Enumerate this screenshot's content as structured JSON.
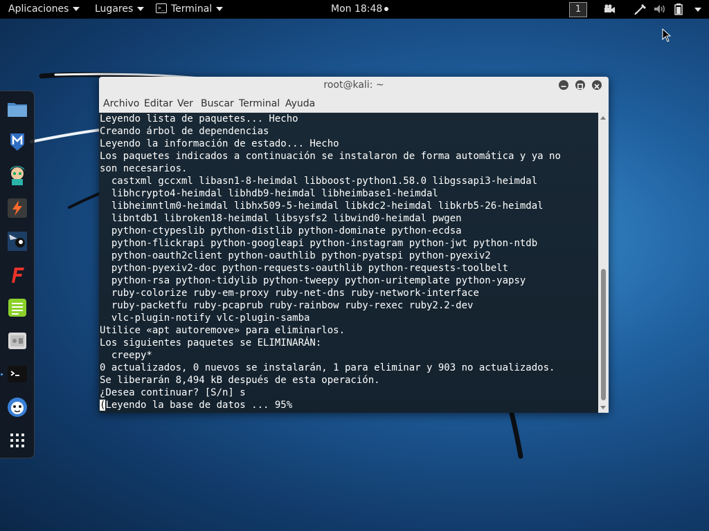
{
  "topbar": {
    "applications": "Aplicaciones",
    "places": "Lugares",
    "app_menu": "Terminal",
    "clock": "Mon 18:48",
    "workspace": "1"
  },
  "dock": {
    "items": [
      "files-icon",
      "metasploit-icon",
      "armitage-icon",
      "burpsuite-icon",
      "maltego-icon",
      "faraday-icon",
      "leafpad-icon",
      "settings-icon",
      "terminal-icon",
      "cherrytree-icon",
      "app-grid-icon"
    ]
  },
  "window": {
    "title": "root@kali: ~",
    "menu": [
      "Archivo",
      "Editar",
      "Ver",
      "Buscar",
      "Terminal",
      "Ayuda"
    ]
  },
  "terminal": {
    "lines": [
      "Leyendo lista de paquetes... Hecho",
      "Creando árbol de dependencias",
      "Leyendo la información de estado... Hecho",
      "Los paquetes indicados a continuación se instalaron de forma automática y ya no",
      "son necesarios.",
      "  castxml gccxml libasn1-8-heimdal libboost-python1.58.0 libgssapi3-heimdal",
      "  libhcrypto4-heimdal libhdb9-heimdal libheimbase1-heimdal",
      "  libheimntlm0-heimdal libhx509-5-heimdal libkdc2-heimdal libkrb5-26-heimdal",
      "  libntdb1 libroken18-heimdal libsysfs2 libwind0-heimdal pwgen",
      "  python-ctypeslib python-distlib python-dominate python-ecdsa",
      "  python-flickrapi python-googleapi python-instagram python-jwt python-ntdb",
      "  python-oauth2client python-oauthlib python-pyatspi python-pyexiv2",
      "  python-pyexiv2-doc python-requests-oauthlib python-requests-toolbelt",
      "  python-rsa python-tidylib python-tweepy python-uritemplate python-yapsy",
      "  ruby-colorize ruby-em-proxy ruby-net-dns ruby-network-interface",
      "  ruby-packetfu ruby-pcaprub ruby-rainbow ruby-rexec ruby2.2-dev",
      "  vlc-plugin-notify vlc-plugin-samba",
      "Utilice «apt autoremove» para eliminarlos.",
      "Los siguientes paquetes se ELIMINARÁN:",
      "  creepy*",
      "0 actualizados, 0 nuevos se instalarán, 1 para eliminar y 903 no actualizados.",
      "Se liberarán 8,494 kB después de esta operación.",
      "¿Desea continuar? [S/n] s"
    ],
    "last_line_cursor": "(",
    "last_line_rest": "Leyendo la base de datos ... 95%"
  }
}
